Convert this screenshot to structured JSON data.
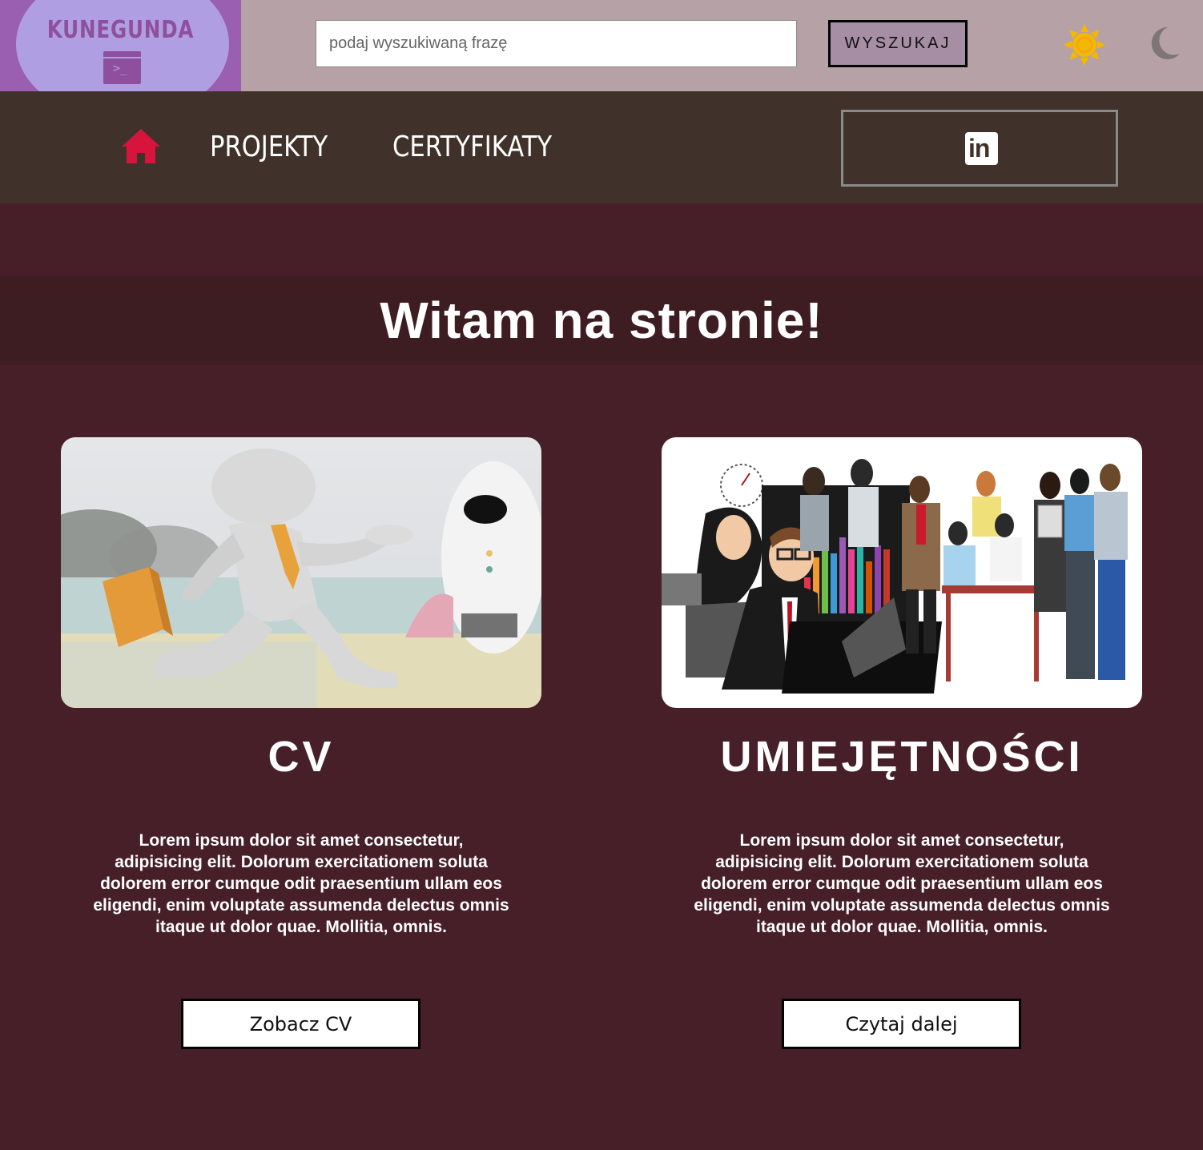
{
  "header": {
    "logo_text": "KUNEGUNDA",
    "logo_terminal_glyph": ">_",
    "search": {
      "placeholder": "podaj wyszukiwaną frazę",
      "button_label": "WYSZUKAJ"
    },
    "theme_icons": {
      "light": "sun-icon",
      "dark": "moon-icon"
    },
    "colors": {
      "topbar": "#b5a1a6",
      "logo_bg": "#9a5fb0",
      "logo_circle": "#b09ee3",
      "search_button": "#a68fa5",
      "sun": "#f5b800",
      "moon": "#7d7578"
    }
  },
  "nav": {
    "home_icon": "home-icon",
    "links": [
      {
        "label": "PROJEKTY"
      },
      {
        "label": "CERTYFIKATY"
      }
    ],
    "social_icon": "linkedin-icon",
    "social_label": "in",
    "colors": {
      "background": "#40322b",
      "home": "#d6143c"
    }
  },
  "banner": {
    "title": "Witam na stronie!"
  },
  "cards": [
    {
      "image": "3d-man-running-with-briefcase-image",
      "title": "CV",
      "text": "Lorem ipsum dolor sit amet consectetur, adipisicing elit. Dolorum exercitationem soluta dolorem error cumque odit praesentium ullam eos eligendi, enim voluptate assumenda delectus omnis itaque ut dolor quae. Mollitia, omnis.",
      "button_label": "Zobacz CV"
    },
    {
      "image": "team-of-office-workers-illustration",
      "title": "UMIEJĘTNOŚCI",
      "text": "Lorem ipsum dolor sit amet consectetur, adipisicing elit. Dolorum exercitationem soluta dolorem error cumque odit praesentium ullam eos eligendi, enim voluptate assumenda delectus omnis itaque ut dolor quae. Mollitia, omnis.",
      "button_label": "Czytaj dalej"
    }
  ],
  "page": {
    "background": "#471f28",
    "banner_background": "#3d1d22"
  }
}
